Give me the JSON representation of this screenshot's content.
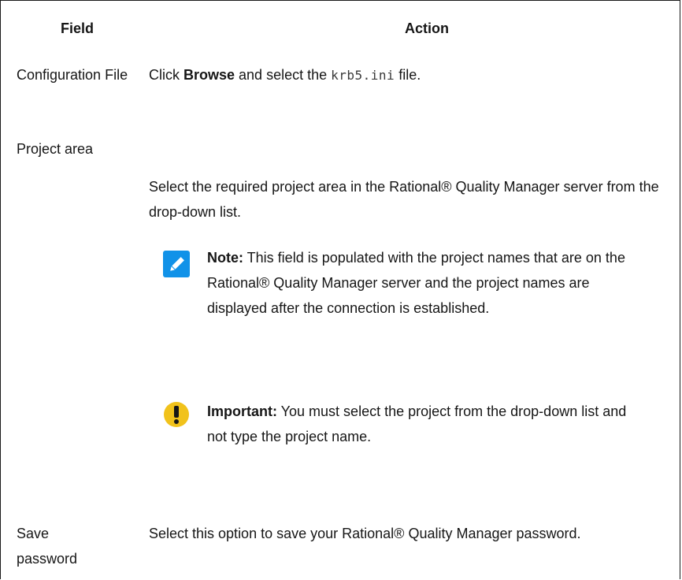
{
  "table": {
    "headers": {
      "field": "Field",
      "action": "Action"
    },
    "rows": [
      {
        "field": "Configuration File",
        "action": {
          "pre": "Click ",
          "bold": "Browse",
          "mid": " and select the ",
          "code": "krb5.ini",
          "post": " file."
        }
      },
      {
        "field": "Project area",
        "action": {
          "text": "Select the required project area in the Rational® Quality Manager server from the drop-down list."
        },
        "note": {
          "label": "Note:",
          "text": " This field is populated with the project names that are on the Rational® Quality Manager server and the project names are displayed after the connection is established."
        },
        "important": {
          "label": "Important:",
          "text": " You must select the project from the drop-down list and not type the project name."
        }
      },
      {
        "field": "Save password",
        "action": {
          "text": "Select this option to save your Rational® Quality Manager password."
        }
      }
    ]
  },
  "colors": {
    "note_icon": "#1192e8",
    "important_icon": "#f1c21b",
    "border": "#1a1a1a"
  },
  "icons": {
    "note": "pencil-icon",
    "important": "exclamation-icon"
  }
}
